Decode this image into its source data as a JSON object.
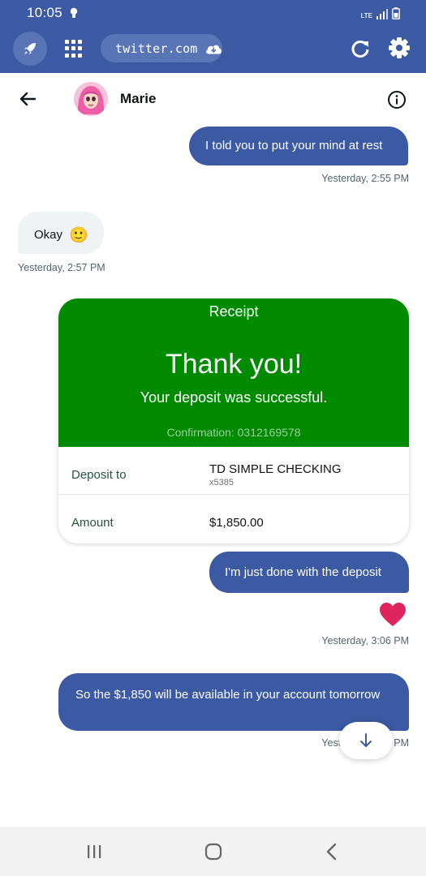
{
  "status_bar": {
    "time": "10:05",
    "network": "LTE"
  },
  "browser": {
    "url": "twitter.com"
  },
  "conversation": {
    "contact_name": "Marie"
  },
  "messages": [
    {
      "direction": "out",
      "text": "I told you to put your mind at rest",
      "timestamp": "Yesterday, 2:55 PM"
    },
    {
      "direction": "in",
      "text": "Okay",
      "emoji": "🙂",
      "timestamp": "Yesterday, 2:57 PM"
    },
    {
      "direction": "out",
      "text": "I'm just done with the deposit",
      "reaction": "heart",
      "timestamp": "Yesterday, 3:06 PM"
    },
    {
      "direction": "out",
      "text": "So the $1,850 will be available in your account tomorrow",
      "timestamp": "Yesterday, 3:06 PM"
    }
  ],
  "receipt": {
    "title": "Receipt",
    "heading": "Thank you!",
    "subheading": "Your deposit was successful.",
    "confirmation": "Confirmation: 0312169578",
    "deposit_to_label": "Deposit to",
    "deposit_to_value": "TD SIMPLE CHECKING",
    "account_suffix": "x5385",
    "amount_label": "Amount",
    "amount_value": "$1,850.00"
  },
  "colors": {
    "toolbar": "#3b5aa3",
    "outgoing_bubble": "#3b5aa3",
    "incoming_bubble": "#eff3f4",
    "receipt_green": "#008a00",
    "heart": "#e0245e"
  }
}
